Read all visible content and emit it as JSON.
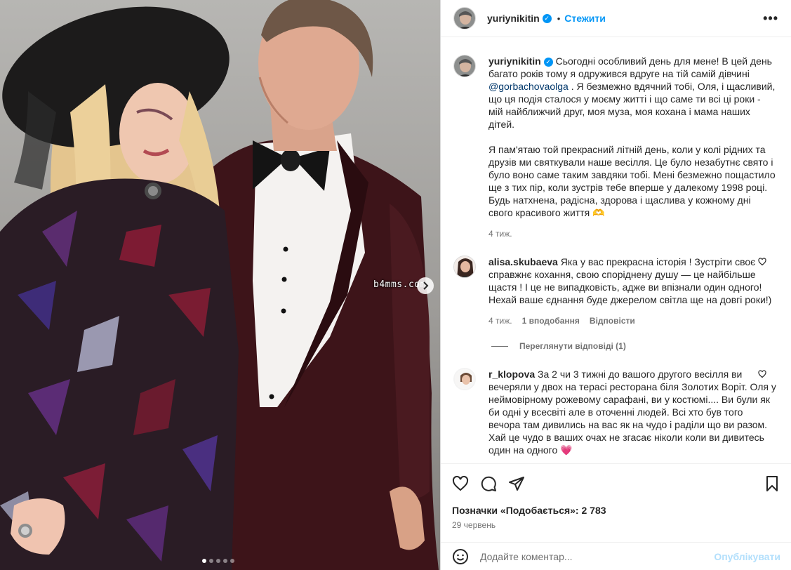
{
  "post": {
    "watermark": "b4mms.com",
    "carousel_dots": 5,
    "active_dot": 0
  },
  "header": {
    "username": "yuriynikitin",
    "follow_label": "Стежити",
    "more_label": "•••"
  },
  "caption": {
    "username": "yuriynikitin",
    "text_part1": "Сьогодні особливий день для мене! В цей день багато років тому я одружився вдруге на тій самій дівчині",
    "mention": "@gorbachovaolga",
    "text_part2": ". Я безмежно вдячний тобі, Оля, і щасливий, що ця подія сталося у моєму житті і що саме ти всі ці роки - мій найближчий друг, моя муза, моя кохана і мама наших дітей.",
    "paragraph2": "Я пам'ятаю той прекрасний літній день, коли у колі рідних та друзів ми святкували наше весілля. Це було незабутнє свято і було воно саме таким завдяки тобі. Мені безмежно пощастило ще з тих пір, коли зустрів тебе вперше у далекому 1998 році. Будь натхнена, радісна, здорова і щаслива у кожному дні свого красивого життя 🫶",
    "time": "4 тиж."
  },
  "comments": [
    {
      "username": "alisa.skubaeva",
      "text": "Яка у вас прекрасна історія ! Зустріти своє справжнє кохання, свою споріднену душу — це найбільше щастя ! І це не випадковість, адже ви впізнали один одного! Нехай ваше єднання буде джерелом світла ще на довгі роки!)",
      "time": "4 тиж.",
      "likes": "1 вподобання",
      "reply": "Відповісти",
      "view_replies": "Переглянути відповіді (1)"
    },
    {
      "username": "r_klopova",
      "text": "За 2 чи 3 тижні до вашого другого весілля ви вечеряли у двох на терасі ресторана біля Золотих Воріт. Оля у неймовірному рожевому сарафані, ви у костюмі.... Ви були як би одні у всесвіті але в оточенні людей. Всі хто був того вечора там дивились на вас як на чудо і раділи що ви разом.",
      "text2": "Хай це чудо в ваших очах не згасає ніколи коли ви дивитесь один на одного 💗"
    }
  ],
  "actions": {
    "likes_text": "Позначки «Подобається»: 2 783",
    "date": "29 червень"
  },
  "add_comment": {
    "placeholder": "Додайте коментар...",
    "publish_label": "Опублікувати"
  },
  "colors": {
    "accent": "#0095f6",
    "mention": "#00376b",
    "muted": "#737373",
    "publish_disabled": "#b2dffc"
  }
}
